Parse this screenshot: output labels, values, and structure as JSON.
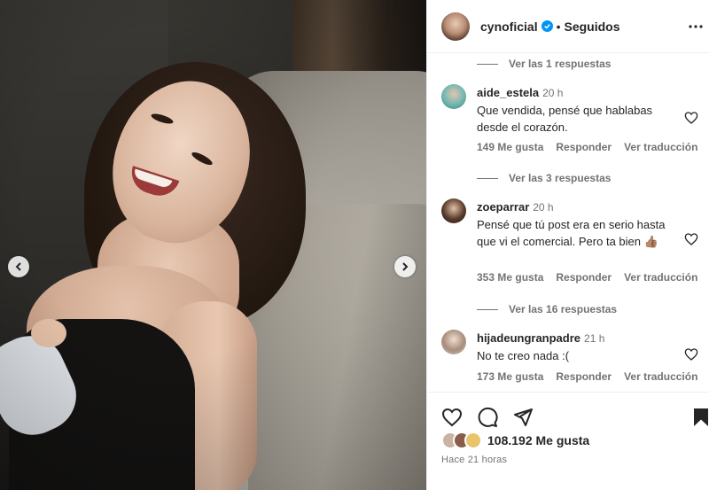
{
  "header": {
    "username": "cynoficial",
    "separator": "•",
    "follow_status": "Seguidos"
  },
  "comments": {
    "replies_1": "Ver las 1 respuestas",
    "items": [
      {
        "username": "aide_estela",
        "time": "20 h",
        "text": "Que vendida, pensé que hablabas desde el corazón.",
        "likes": "149 Me gusta",
        "reply": "Responder",
        "translate": "Ver traducción",
        "replies": "Ver las 3 respuestas"
      },
      {
        "username": "zoeparrar",
        "time": "20 h",
        "text": "Pensé que tú post era en serio hasta que vi el comercial. Pero ta bien 👍🏽",
        "likes": "353 Me gusta",
        "reply": "Responder",
        "translate": "Ver traducción",
        "replies": "Ver las 16 respuestas"
      },
      {
        "username": "hijadeungranpadre",
        "time": "21 h",
        "text": "No te creo nada :(",
        "likes": "173 Me gusta",
        "reply": "Responder",
        "translate": "Ver traducción"
      }
    ]
  },
  "post": {
    "likes": "108.192 Me gusta",
    "posted": "Hace 21 horas"
  },
  "icons": {
    "verified": "verified-badge-icon",
    "more": "more-options-icon",
    "heart": "heart-icon",
    "comment": "comment-icon",
    "share": "share-icon",
    "save": "bookmark-icon",
    "prev": "chevron-left-icon",
    "next": "chevron-right-icon"
  },
  "colors": {
    "verified": "#0095f6",
    "text": "#262626",
    "secondary": "#737373"
  }
}
